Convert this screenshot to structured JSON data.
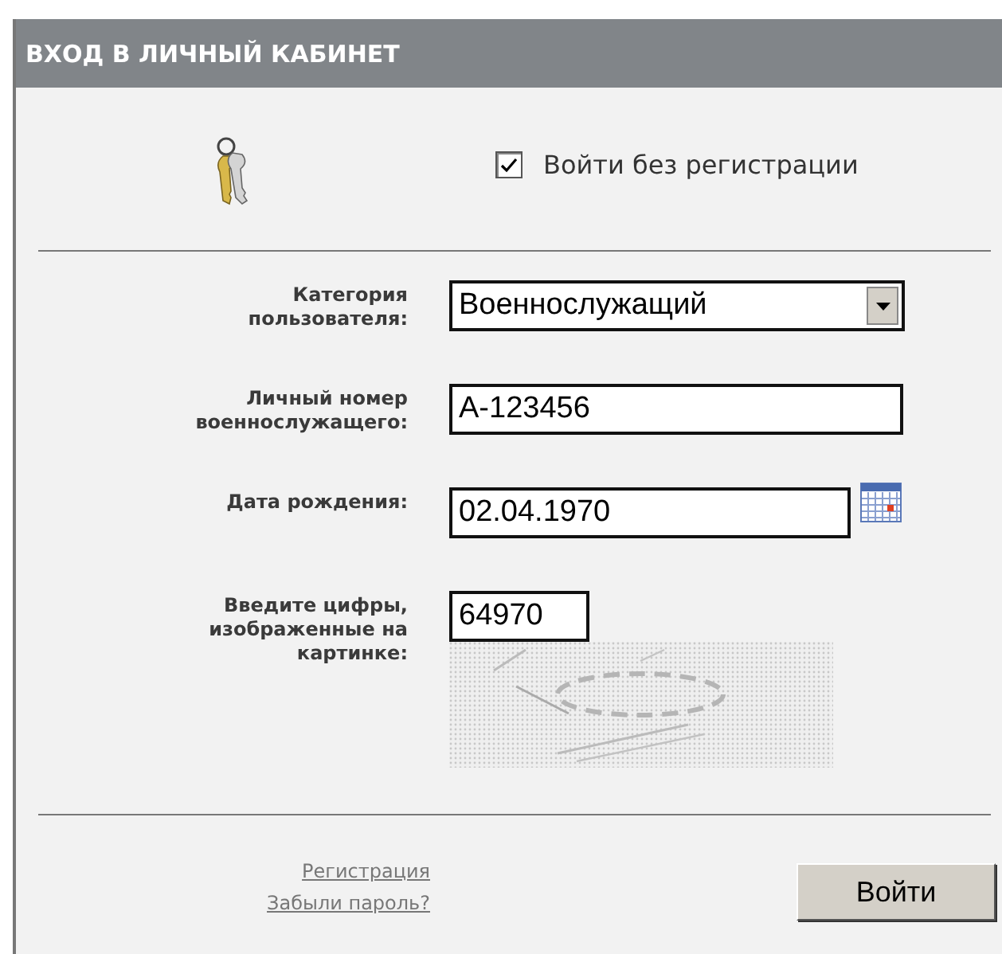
{
  "header": {
    "title": "ВХОД В ЛИЧНЫЙ КАБИНЕТ"
  },
  "guest_login": {
    "label": "Войти без регистрации",
    "checked": true
  },
  "fields": [
    {
      "kind": "select",
      "label": "Категория пользователя:",
      "value": "Военнослужащий"
    },
    {
      "kind": "text",
      "label": "Личный номер военнослужащего:",
      "value": "А-123456"
    },
    {
      "kind": "date",
      "label": "Дата рождения:",
      "value": "02.04.1970"
    },
    {
      "kind": "captcha",
      "label": "Введите цифры, изображенные на картинке:",
      "value": "64970"
    }
  ],
  "links": [
    "Регистрация",
    "Забыли пароль?"
  ],
  "submit": {
    "label": "Войти"
  }
}
